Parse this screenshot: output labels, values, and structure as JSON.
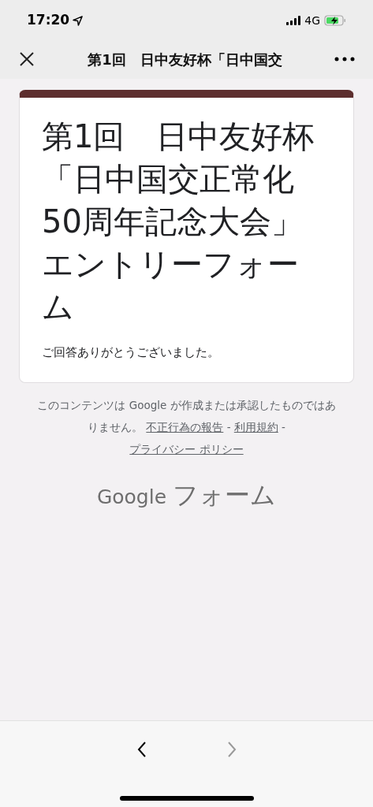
{
  "status_bar": {
    "time": "17:20",
    "network": "4G"
  },
  "nav": {
    "title": "第1回　日中友好杯「日中国交"
  },
  "card": {
    "title": "第1回　日中友好杯「日中国交正常化50周年記念大会」エントリーフォーム",
    "message": "ご回答ありがとうございました。"
  },
  "footer": {
    "disclaimer": "このコンテンツは Google が作成または承認したものではありません。",
    "links": [
      "不正行為の報告",
      "利用規約",
      "プライバシー ポリシー"
    ],
    "separator": "-",
    "brand_google": "Google",
    "brand_product": "フォーム"
  },
  "toolbar": {
    "back": {
      "disabled": false
    },
    "forward": {
      "disabled": true
    }
  }
}
